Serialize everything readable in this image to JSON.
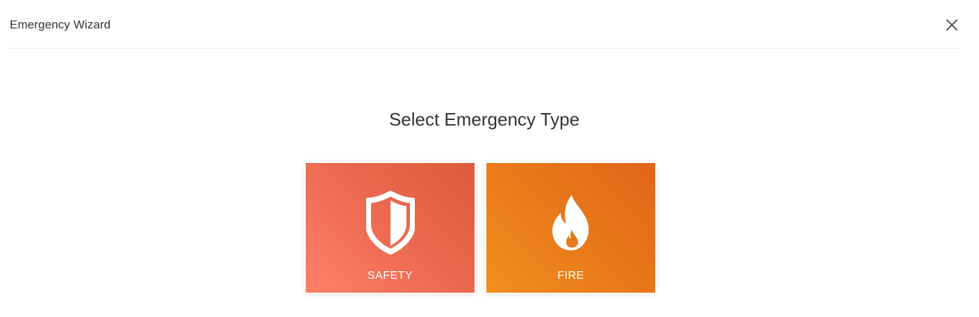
{
  "wizard": {
    "title": "Emergency Wizard",
    "close_icon": "close-icon"
  },
  "main": {
    "heading": "Select Emergency Type",
    "types": [
      {
        "label": "SAFETY",
        "icon": "shield-icon",
        "color_start": "#ff7f68",
        "color_end": "#df5a3c"
      },
      {
        "label": "FIRE",
        "icon": "flame-icon",
        "color_start": "#f28e1e",
        "color_end": "#e0661a"
      }
    ]
  }
}
